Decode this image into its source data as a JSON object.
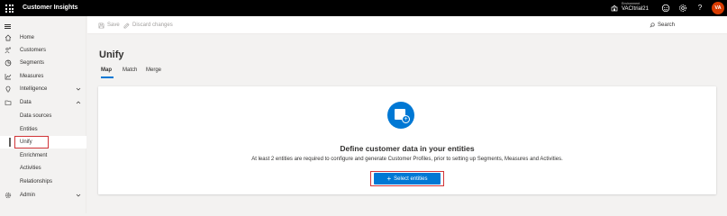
{
  "header": {
    "app_title": "Customer Insights",
    "environment_label": "Environment",
    "environment_name": "VACItrial21",
    "avatar_initials": "VA",
    "help_glyph": "?"
  },
  "sidebar": {
    "items": [
      {
        "label": "Home",
        "icon": "home-icon"
      },
      {
        "label": "Customers",
        "icon": "customers-icon"
      },
      {
        "label": "Segments",
        "icon": "segments-icon"
      },
      {
        "label": "Measures",
        "icon": "measures-icon"
      },
      {
        "label": "Intelligence",
        "icon": "lightbulb-icon",
        "expanded": false
      },
      {
        "label": "Data",
        "icon": "data-icon",
        "expanded": true
      },
      {
        "label": "Data sources"
      },
      {
        "label": "Entities"
      },
      {
        "label": "Unify",
        "selected": true
      },
      {
        "label": "Enrichment"
      },
      {
        "label": "Activities"
      },
      {
        "label": "Relationships"
      },
      {
        "label": "Admin",
        "icon": "gear-icon",
        "expanded": false
      }
    ]
  },
  "command_bar": {
    "save_label": "Save",
    "discard_label": "Discard changes",
    "search_label": "Search"
  },
  "main": {
    "title": "Unify",
    "tabs": [
      {
        "label": "Map",
        "active": true
      },
      {
        "label": "Match",
        "active": false
      },
      {
        "label": "Merge",
        "active": false
      }
    ],
    "empty_state": {
      "headline": "Define customer data in your entities",
      "description": "At least 2 entities are required to configure and generate Customer Profiles, prior to setting up Segments, Measures and Activities.",
      "button_label": "Select entities"
    }
  },
  "colors": {
    "accent": "#0078d4",
    "highlight": "#d13438",
    "topbar": "#000000",
    "avatar": "#d83b01"
  }
}
